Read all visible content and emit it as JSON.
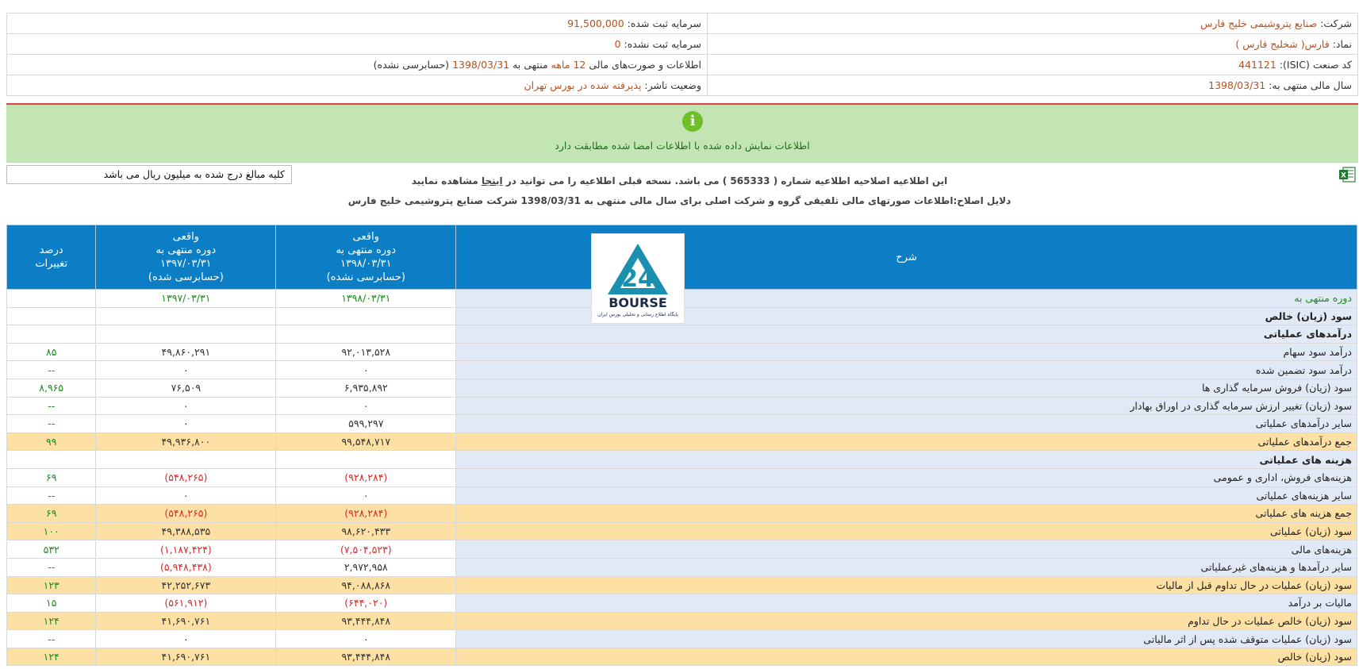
{
  "info": {
    "company_label": "شرکت:",
    "company_value": "صنایع پتروشیمی خلیج فارس",
    "symbol_label": "نماد:",
    "symbol_value": "فارس( شخلیج فارس )",
    "isic_label": "کد صنعت (ISIC):",
    "isic_value": "441121",
    "fiscal_label": "سال مالی منتهی به:",
    "fiscal_value": "1398/03/31",
    "capital_reg_label": "سرمایه ثبت شده:",
    "capital_reg_value": "91,500,000",
    "capital_unreg_label": "سرمایه ثبت نشده:",
    "capital_unreg_value": "0",
    "report_prefix": "اطلاعات و صورت‌های مالی",
    "report_months": "12 ماهه",
    "report_mid": "منتهی به",
    "report_date": "1398/03/31",
    "report_audit": "(حسابرسی نشده)",
    "status_label": "وضعیت ناشر:",
    "status_value": "پذیرفته شده در بورس تهران"
  },
  "alert": {
    "icon": "info-icon",
    "message": "اطلاعات نمایش داده شده با اطلاعات امضا شده مطابقت دارد"
  },
  "unit_note": "کلیه مبالغ درج شده به میلیون ریال می باشد",
  "notice1_a": "این اطلاعیه اصلاحیه اطلاعیه شماره ( 565333 ) می باشد. نسخه قبلی اطلاعیه را می توانید در",
  "notice1_link": "اینجا",
  "notice1_b": "مشاهده نمایید",
  "notice2": "دلایل اصلاح:اطلاعات صورتهای مالی تلفیقی گروه و شرکت اصلی برای سال مالی منتهی به 1398/03/31 شرکت صنایع پتروشیمی خلیج فارس",
  "watermark": {
    "icon": "bourse24-logo",
    "line1": "BOURSE",
    "line2": "پایگاه اطلاع رسانی و تحلیلی بورس ایران"
  },
  "table": {
    "headers": {
      "desc": "شرح",
      "cur_l1": "واقعی",
      "cur_l2": "دوره منتهی به",
      "cur_l3": "۱۳۹۸/۰۳/۳۱",
      "cur_l4": "(حسابرسی نشده)",
      "prev_l1": "واقعی",
      "prev_l2": "دوره منتهی به",
      "prev_l3": "۱۳۹۷/۰۳/۳۱",
      "prev_l4": "(حسابرسی شده)",
      "pct_l1": "درصد",
      "pct_l2": "تغییرات"
    },
    "rows": [
      {
        "desc": "دوره منتهی به",
        "cur": "۱۳۹۸/۰۳/۳۱",
        "prev": "۱۳۹۷/۰۳/۳۱",
        "pct": ""
      },
      {
        "desc": "سود (زیان) خالص",
        "cur": "",
        "prev": "",
        "pct": ""
      },
      {
        "desc": "درآمدهای عملیاتی",
        "cur": "",
        "prev": "",
        "pct": ""
      },
      {
        "desc": "درآمد سود سهام",
        "cur": "۹۲,۰۱۳,۵۲۸",
        "prev": "۴۹,۸۶۰,۲۹۱",
        "pct": "۸۵"
      },
      {
        "desc": "درآمد سود تضمین شده",
        "cur": "۰",
        "prev": "۰",
        "pct": "--"
      },
      {
        "desc": "سود (زیان) فروش سرمایه گذاری ها",
        "cur": "۶,۹۳۵,۸۹۲",
        "prev": "۷۶,۵۰۹",
        "pct": "۸,۹۶۵"
      },
      {
        "desc": "سود (زیان) تغییر ارزش سرمایه گذاری در اوراق بهادار",
        "cur": "۰",
        "prev": "۰",
        "pct": "--"
      },
      {
        "desc": "سایر درآمدهای عملیاتی",
        "cur": "۵۹۹,۲۹۷",
        "prev": "۰",
        "pct": "--"
      },
      {
        "desc": "جمع درآمدهای عملیاتی",
        "cur": "۹۹,۵۴۸,۷۱۷",
        "prev": "۴۹,۹۳۶,۸۰۰",
        "pct": "۹۹"
      },
      {
        "desc": "هزینه های عملیاتی",
        "cur": "",
        "prev": "",
        "pct": ""
      },
      {
        "desc": "هزینه‌های فروش، اداری و عمومی",
        "cur": "(۹۲۸,۲۸۴)",
        "prev": "(۵۴۸,۲۶۵)",
        "pct": "۶۹"
      },
      {
        "desc": "سایر هزینه‌های عملیاتی",
        "cur": "۰",
        "prev": "۰",
        "pct": "--"
      },
      {
        "desc": "جمع هزینه های عملیاتی",
        "cur": "(۹۲۸,۲۸۴)",
        "prev": "(۵۴۸,۲۶۵)",
        "pct": "۶۹"
      },
      {
        "desc": "سود (زیان) عملیاتی",
        "cur": "۹۸,۶۲۰,۴۳۳",
        "prev": "۴۹,۳۸۸,۵۳۵",
        "pct": "۱۰۰"
      },
      {
        "desc": "هزینه‌های مالی",
        "cur": "(۷,۵۰۴,۵۲۳)",
        "prev": "(۱,۱۸۷,۴۲۴)",
        "pct": "۵۳۲"
      },
      {
        "desc": "سایر درآمدها و هزینه‌های غیرعملیاتی",
        "cur": "۲,۹۷۲,۹۵۸",
        "prev": "(۵,۹۴۸,۴۳۸)",
        "pct": "--"
      },
      {
        "desc": "سود (زیان) عملیات در حال تداوم قبل از مالیات",
        "cur": "۹۴,۰۸۸,۸۶۸",
        "prev": "۴۲,۲۵۲,۶۷۳",
        "pct": "۱۲۳"
      },
      {
        "desc": "مالیات بر درآمد",
        "cur": "(۶۴۴,۰۲۰)",
        "prev": "(۵۶۱,۹۱۲)",
        "pct": "۱۵"
      },
      {
        "desc": "سود (زیان) خالص عملیات در حال تداوم",
        "cur": "۹۳,۴۴۴,۸۴۸",
        "prev": "۴۱,۶۹۰,۷۶۱",
        "pct": "۱۲۴"
      },
      {
        "desc": "سود (زیان) عملیات متوقف شده پس از اثر مالیاتی",
        "cur": "۰",
        "prev": "۰",
        "pct": "--"
      },
      {
        "desc": "سود (زیان) خالص",
        "cur": "۹۳,۴۴۴,۸۴۸",
        "prev": "۴۱,۶۹۰,۷۶۱",
        "pct": "۱۲۴"
      }
    ]
  }
}
